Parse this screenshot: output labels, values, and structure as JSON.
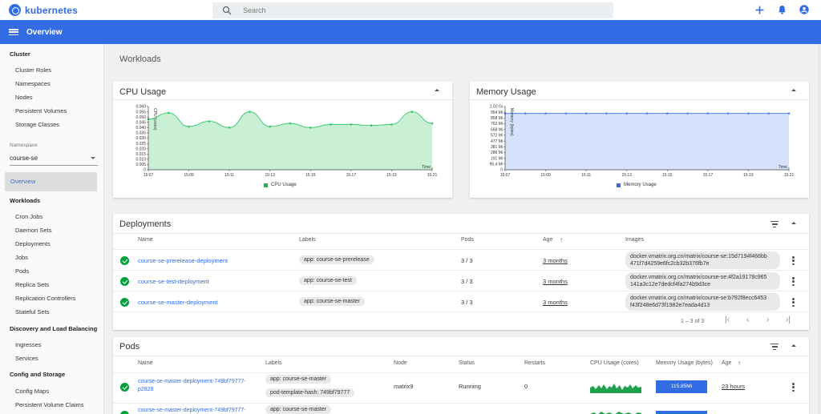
{
  "header": {
    "app_name": "kubernetes",
    "search_placeholder": "Search",
    "icons": [
      "add-icon",
      "bell-icon",
      "account-icon"
    ]
  },
  "titlebar": {
    "title": "Overview"
  },
  "sidebar": {
    "cluster_header": "Cluster",
    "cluster_items": [
      "Cluster Roles",
      "Namespaces",
      "Nodes",
      "Persistent Volumes",
      "Storage Classes"
    ],
    "namespace_label": "Namespace",
    "namespace_value": "course-se",
    "overview": "Overview",
    "workloads_header": "Workloads",
    "workloads_items": [
      "Cron Jobs",
      "Daemon Sets",
      "Deployments",
      "Jobs",
      "Pods",
      "Replica Sets",
      "Replication Controllers",
      "Stateful Sets"
    ],
    "discovery_header": "Discovery and Load Balancing",
    "discovery_items": [
      "Ingresses",
      "Services"
    ],
    "config_header": "Config and Storage",
    "config_items": [
      "Config Maps",
      "Persistent Volume Claims"
    ]
  },
  "main": {
    "section_title": "Workloads",
    "cpu_card": {
      "title": "CPU Usage",
      "legend": "CPU Usage",
      "y_label": "CPU (cores)",
      "x_label": "Time",
      "color": "#2ecc71"
    },
    "memory_card": {
      "title": "Memory Usage",
      "legend": "Memory Usage",
      "y_label": "Memory (bytes)",
      "x_label": "Time",
      "color": "#326ce5"
    },
    "deployments": {
      "title": "Deployments",
      "columns": [
        "Name",
        "Labels",
        "Pods",
        "Age",
        "Images"
      ],
      "rows": [
        {
          "name": "course-se-prerelease-deployment",
          "label": "app: course-se-prerelease",
          "pods": "3 / 3",
          "age": "3 months",
          "image_1": "docker.vmatrix.org.cn/matrix/course-se:15d7194f466bb",
          "image_2": "471f7d4259e6fc2cb32b376fb7e"
        },
        {
          "name": "course-se-test-deployment",
          "label": "app: course-se-test",
          "pods": "3 / 3",
          "age": "3 months",
          "image_1": "docker.vmatrix.org.cn/matrix/course-se:4f2a19178c965",
          "image_2": "141a3c12e7dedcf4fa274b9d3ce"
        },
        {
          "name": "course-se-master-deployment",
          "label": "app: course-se-master",
          "pods": "3 / 3",
          "age": "3 months",
          "image_1": "docker.vmatrix.org.cn/matrix/course-se:b792f8ecc6453",
          "image_2": "f43f248e6d73f1982e7eada4d13"
        }
      ],
      "pagination": "1 – 3 of 3"
    },
    "pods": {
      "title": "Pods",
      "columns": [
        "Name",
        "Labels",
        "Node",
        "Status",
        "Restarts",
        "CPU Usage (cores)",
        "Memory Usage (bytes)",
        "Age"
      ],
      "rows": [
        {
          "name_1": "course-se-master-deployment-749bf79777-",
          "name_2": "p2828",
          "label_1": "app: course-se-master",
          "label_2": "pod-template-hash: 749bf79777",
          "node": "matrix9",
          "status": "Running",
          "restarts": "0",
          "memory": "115.85Mi",
          "age": "23 hours"
        },
        {
          "name_1": "course-se-master-deployment-749bf79777-",
          "label_1": "app: course-se-master"
        }
      ]
    }
  },
  "chart_data": [
    {
      "type": "area",
      "title": "CPU Usage",
      "ylabel": "CPU (cores)",
      "xlabel": "Time",
      "y_ticks": [
        "0.060",
        "0.055",
        "0.050",
        "0.045",
        "0.040",
        "0.035",
        "0.030",
        "0.025",
        "0.020",
        "0.015",
        "0.010",
        "0.005",
        "0"
      ],
      "x_ticks": [
        "15:07",
        "15:09",
        "15:11",
        "15:13",
        "15:15",
        "15:17",
        "15:19",
        "15:21"
      ],
      "ylim": [
        0,
        0.06
      ],
      "xlim": [
        0,
        14
      ],
      "x": [
        0,
        1,
        2,
        3,
        4,
        5,
        6,
        7,
        8,
        9,
        10,
        11,
        12,
        13,
        14
      ],
      "values": [
        0.048,
        0.054,
        0.041,
        0.046,
        0.04,
        0.055,
        0.041,
        0.044,
        0.04,
        0.043,
        0.043,
        0.042,
        0.043,
        0.055,
        0.044
      ],
      "legend": "CPU Usage",
      "color": "#2ecc71"
    },
    {
      "type": "area",
      "title": "Memory Usage",
      "ylabel": "Memory (bytes)",
      "xlabel": "Time",
      "y_ticks": [
        "1.02 Gi",
        "954 Mi",
        "858 Mi",
        "763 Mi",
        "668 Mi",
        "572 Mi",
        "477 Mi",
        "381 Mi",
        "286 Mi",
        "191 Mi",
        "95.4 Mi",
        "0"
      ],
      "x_ticks": [
        "15:07",
        "15:09",
        "15:11",
        "15:13",
        "15:15",
        "15:17",
        "15:19",
        "15:21"
      ],
      "ylim": [
        0,
        1044
      ],
      "xlim": [
        0,
        14
      ],
      "x": [
        0,
        1,
        2,
        3,
        4,
        5,
        6,
        7,
        8,
        9,
        10,
        11,
        12,
        13,
        14
      ],
      "values": [
        930,
        930,
        930,
        930,
        930,
        930,
        930,
        930,
        930,
        930,
        930,
        930,
        930,
        930,
        930
      ],
      "legend": "Memory Usage",
      "color": "#326ce5"
    }
  ]
}
